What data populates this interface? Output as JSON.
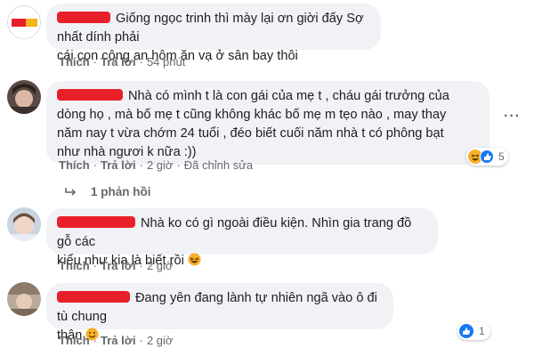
{
  "comments": [
    {
      "text": "Giống ngọc trinh thì mày lại ơn giời đấy Sợ nhất dính phải cái con công an hôm ăn vạ ở sân bay thôi",
      "line1": "Giống ngọc trinh thì mày lại ơn giời đấy Sợ nhất dính phải",
      "line2": "cái con công an hôm ăn vạ ở sân bay thôi",
      "like": "Thích",
      "reply": "Trả lời",
      "time": "54 phút"
    },
    {
      "line1": "Nhà có mình t là con gái của mẹ t , cháu gái trưởng của",
      "line2": "dòng họ , mà bố mẹ t cũng không khác bố mẹ m tẹo nào , may thay",
      "line3": "năm nay t vừa chớm 24 tuổi , đéo biết cuối năm nhà t có phông bạt",
      "line4": "như nhà ngươi k nữa :))",
      "like": "Thích",
      "reply": "Trả lời",
      "time": "2 giờ",
      "edited": "Đã chỉnh sửa",
      "reaction_count": "5",
      "replies_label": "1 phản hồi"
    },
    {
      "line1": "Nhà ko có gì ngoài điều kiện. Nhìn gia trang đồ gỗ các",
      "line2": "kiểu như kia là biết rồi",
      "like": "Thích",
      "reply": "Trả lời",
      "time": "2 giờ"
    },
    {
      "line1": "Đang yên đang lành tự nhiên ngã vào ô đi tù chung",
      "line2": "thân",
      "like": "Thích",
      "reply": "Trả lời",
      "time": "2 giờ",
      "reaction_count": "1"
    }
  ],
  "separator": "·",
  "colors": {
    "redaction": "#e8202a",
    "bubble": "#f0f2f5",
    "meta": "#65676b",
    "like_blue": "#1877f2",
    "haha_yellow": "#f7b125"
  }
}
